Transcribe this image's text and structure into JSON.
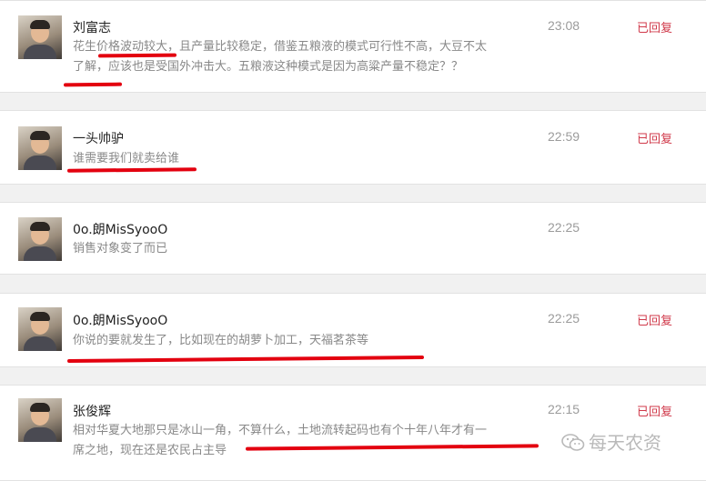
{
  "comments": [
    {
      "name": "刘富志",
      "time": "23:08",
      "status": "已回复",
      "lines": [
        "花生价格波动较大，且产量比较稳定，借鉴五粮液的模式可行性不高，大豆不太",
        "了解，应该也是受国外冲击大。五粮液这种模式是因为高粱产量不稳定？？"
      ]
    },
    {
      "name": "一头帅驴",
      "time": "22:59",
      "status": "已回复",
      "lines": [
        "谁需要我们就卖给谁"
      ]
    },
    {
      "name": "0o.朗MisSyooO",
      "time": "22:25",
      "status": "",
      "lines": [
        "销售对象变了而已"
      ]
    },
    {
      "name": "0o.朗MisSyooO",
      "time": "22:25",
      "status": "已回复",
      "lines": [
        "你说的要就发生了，比如现在的胡萝卜加工，天福茗茶等"
      ]
    },
    {
      "name": "张俊辉",
      "time": "22:15",
      "status": "已回复",
      "lines": [
        "相对华夏大地那只是冰山一角，不算什么，土地流转起码也有个十年八年才有一",
        "席之地，现在还是农民占主导"
      ]
    }
  ],
  "watermark": {
    "text": "每天农资",
    "icon": "wechat-icon"
  },
  "colors": {
    "status": "#d0394a",
    "highlight": "#e3000f",
    "background": "#f1f1f1"
  }
}
